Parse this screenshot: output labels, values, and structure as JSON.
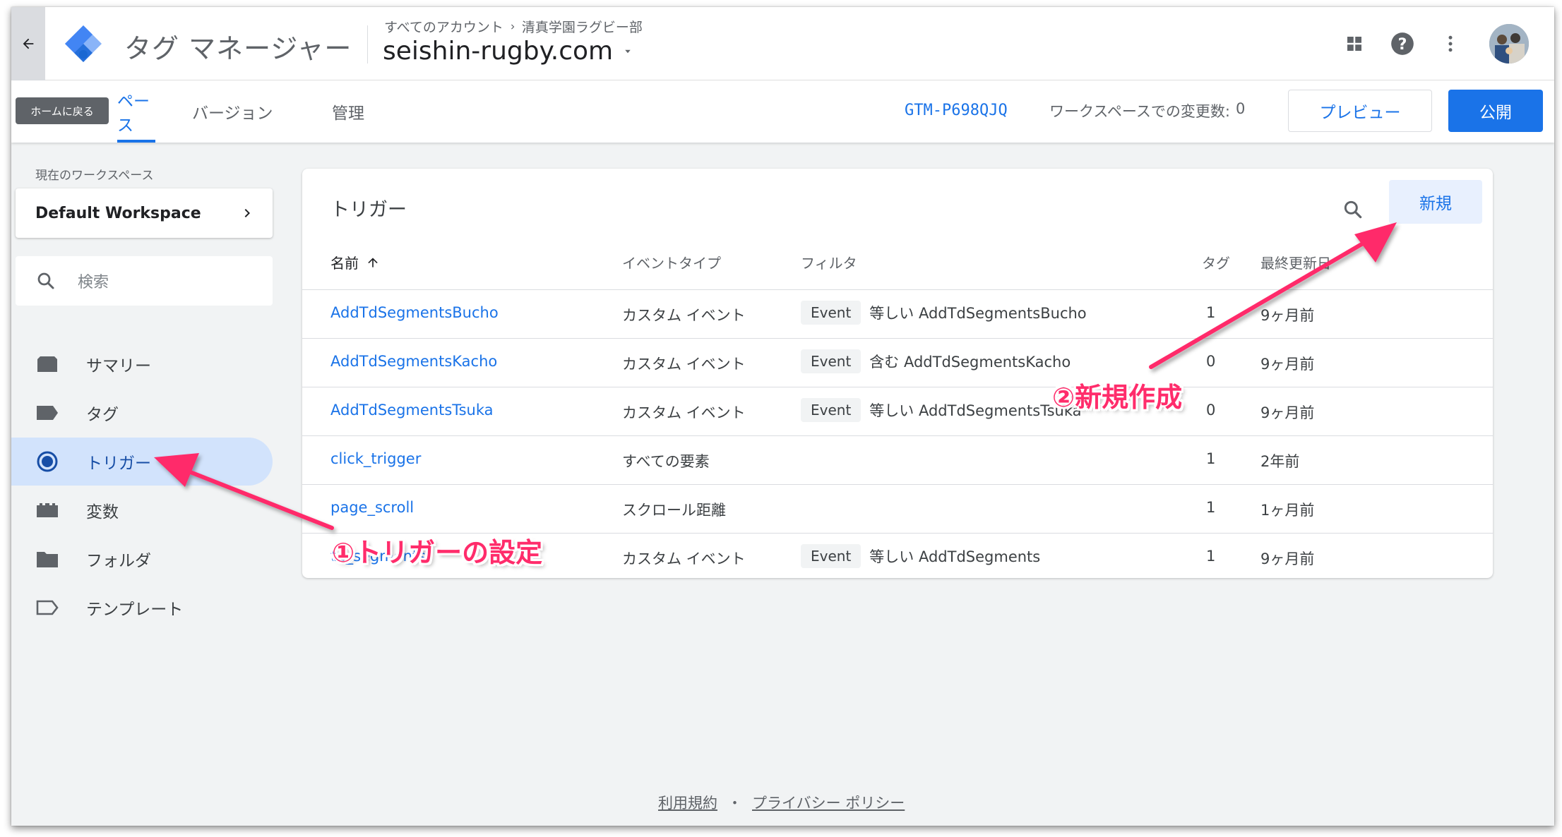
{
  "header": {
    "app_title": "タグ マネージャー",
    "breadcrumb": {
      "all_accounts": "すべてのアカウント",
      "account": "清真学園ラグビー部"
    },
    "container_name": "seishin-rugby.com",
    "icons": [
      "back-arrow-icon",
      "gtm-logo",
      "apps-grid-icon",
      "help-icon",
      "more-vert-icon",
      "avatar"
    ]
  },
  "subnav": {
    "tooltip": "ホームに戻る",
    "tabs": [
      {
        "label": "ワークスペース",
        "visible_label": "ペース",
        "active": true
      },
      {
        "label": "バージョン",
        "active": false
      },
      {
        "label": "管理",
        "active": false
      }
    ],
    "container_id": "GTM-P698QJQ",
    "changes_label": "ワークスペースでの変更数:",
    "changes_count": "0",
    "preview_label": "プレビュー",
    "publish_label": "公開"
  },
  "sidebar": {
    "workspace_label": "現在のワークスペース",
    "workspace_name": "Default Workspace",
    "search_placeholder": "検索",
    "items": [
      {
        "label": "サマリー",
        "icon": "summary-icon",
        "active": false
      },
      {
        "label": "タグ",
        "icon": "tag-icon",
        "active": false
      },
      {
        "label": "トリガー",
        "icon": "trigger-icon",
        "active": true
      },
      {
        "label": "変数",
        "icon": "variables-icon",
        "active": false
      },
      {
        "label": "フォルダ",
        "icon": "folder-icon",
        "active": false
      },
      {
        "label": "テンプレート",
        "icon": "template-icon",
        "active": false
      }
    ]
  },
  "main": {
    "title": "トリガー",
    "new_button": "新規",
    "columns": {
      "name": "名前",
      "event_type": "イベントタイプ",
      "filter": "フィルタ",
      "tags": "タグ",
      "last_updated": "最終更新日"
    },
    "rows": [
      {
        "name": "AddTdSegmentsBucho",
        "event_type": "カスタム イベント",
        "filter_chip": "Event",
        "filter_text": "等しい AddTdSegmentsBucho",
        "tags": "1",
        "last_updated": "9ヶ月前"
      },
      {
        "name": "AddTdSegmentsKacho",
        "event_type": "カスタム イベント",
        "filter_chip": "Event",
        "filter_text": "含む AddTdSegmentsKacho",
        "tags": "0",
        "last_updated": "9ヶ月前"
      },
      {
        "name": "AddTdSegmentsTsuka",
        "event_type": "カスタム イベント",
        "filter_chip": "Event",
        "filter_text": "等しい AddTdSegmentsTsuka",
        "tags": "0",
        "last_updated": "9ヶ月前"
      },
      {
        "name": "click_trigger",
        "event_type": "すべての要素",
        "filter_chip": "",
        "filter_text": "",
        "tags": "1",
        "last_updated": "2年前"
      },
      {
        "name": "page_scroll",
        "event_type": "スクロール距離",
        "filter_chip": "",
        "filter_text": "",
        "tags": "1",
        "last_updated": "1ヶ月前"
      },
      {
        "name": "td_segments",
        "event_type": "カスタム イベント",
        "filter_chip": "Event",
        "filter_text": "等しい AddTdSegments",
        "tags": "1",
        "last_updated": "9ヶ月前"
      }
    ]
  },
  "footer": {
    "terms": "利用規約",
    "separator": "・",
    "privacy": "プライバシー ポリシー"
  },
  "annotations": {
    "step1": "①トリガーの設定",
    "step2": "②新規作成",
    "color": "#ff2c6b"
  },
  "colors": {
    "accent": "#1a73e8",
    "active_bg": "#d2e3fc",
    "page_bg": "#f1f3f4"
  }
}
